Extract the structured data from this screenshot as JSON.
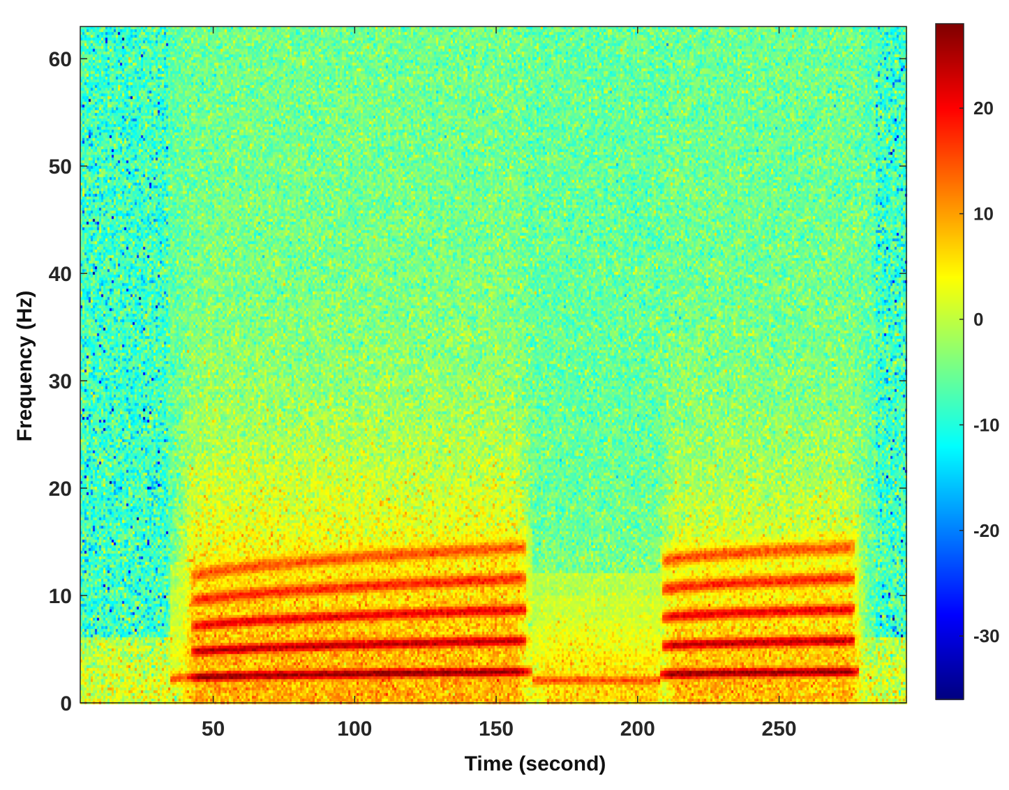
{
  "chart_data": {
    "type": "heatmap",
    "title": "",
    "xlabel": "Time (second)",
    "ylabel": "Frequency (Hz)",
    "xlim": [
      3,
      295
    ],
    "ylim": [
      0,
      63
    ],
    "x_ticks": [
      50,
      100,
      150,
      200,
      250
    ],
    "y_ticks": [
      0,
      10,
      20,
      30,
      40,
      50,
      60
    ],
    "colorbar": {
      "colormap": "jet",
      "clim": [
        -36,
        28
      ],
      "ticks": [
        -30,
        -20,
        -10,
        0,
        10,
        20
      ],
      "position": "right"
    },
    "background_level_dB": -8,
    "harmonic_ridges": {
      "segments": [
        {
          "time_range": [
            35,
            163
          ],
          "fundamental_Hz": [
            2.2,
            2.9
          ]
        },
        {
          "time_range": [
            163,
            208
          ],
          "fundamental_Hz": [
            2.1,
            2.1
          ]
        },
        {
          "time_range": [
            208,
            278
          ],
          "fundamental_Hz": [
            2.6,
            2.9
          ]
        }
      ],
      "harmonic_numbers": [
        1,
        2,
        3,
        4,
        5
      ],
      "peak_level_dB": 27
    },
    "broadband_energy_regions": [
      {
        "time_range": [
          40,
          160
        ],
        "upper_freq_Hz": 28,
        "level_dB": 3
      },
      {
        "time_range": [
          210,
          278
        ],
        "upper_freq_Hz": 25,
        "level_dB": 2
      },
      {
        "time_range": [
          165,
          208
        ],
        "upper_freq_Hz": 12,
        "level_dB": 0
      }
    ],
    "grid": false
  }
}
